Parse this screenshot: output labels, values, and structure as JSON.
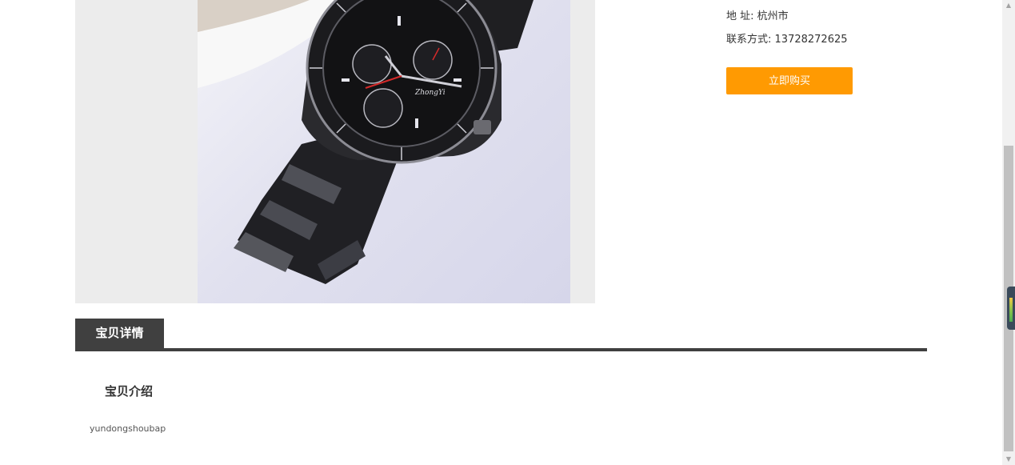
{
  "product": {
    "image_alt": "运动手表",
    "watch_brand_text": "ZhongYi"
  },
  "info": {
    "address_label": "地 址:",
    "address_value": "杭州市",
    "phone_label": "联系方式:",
    "phone_value": "13728272625",
    "buy_button_label": "立即购买",
    "accent_color": "#ff9a02"
  },
  "details": {
    "tab_label": "宝贝详情",
    "section_title": "宝贝介绍",
    "description": "yundongshoubap"
  },
  "scrollbar": {
    "up_arrow": "▲",
    "down_arrow": "▼"
  }
}
